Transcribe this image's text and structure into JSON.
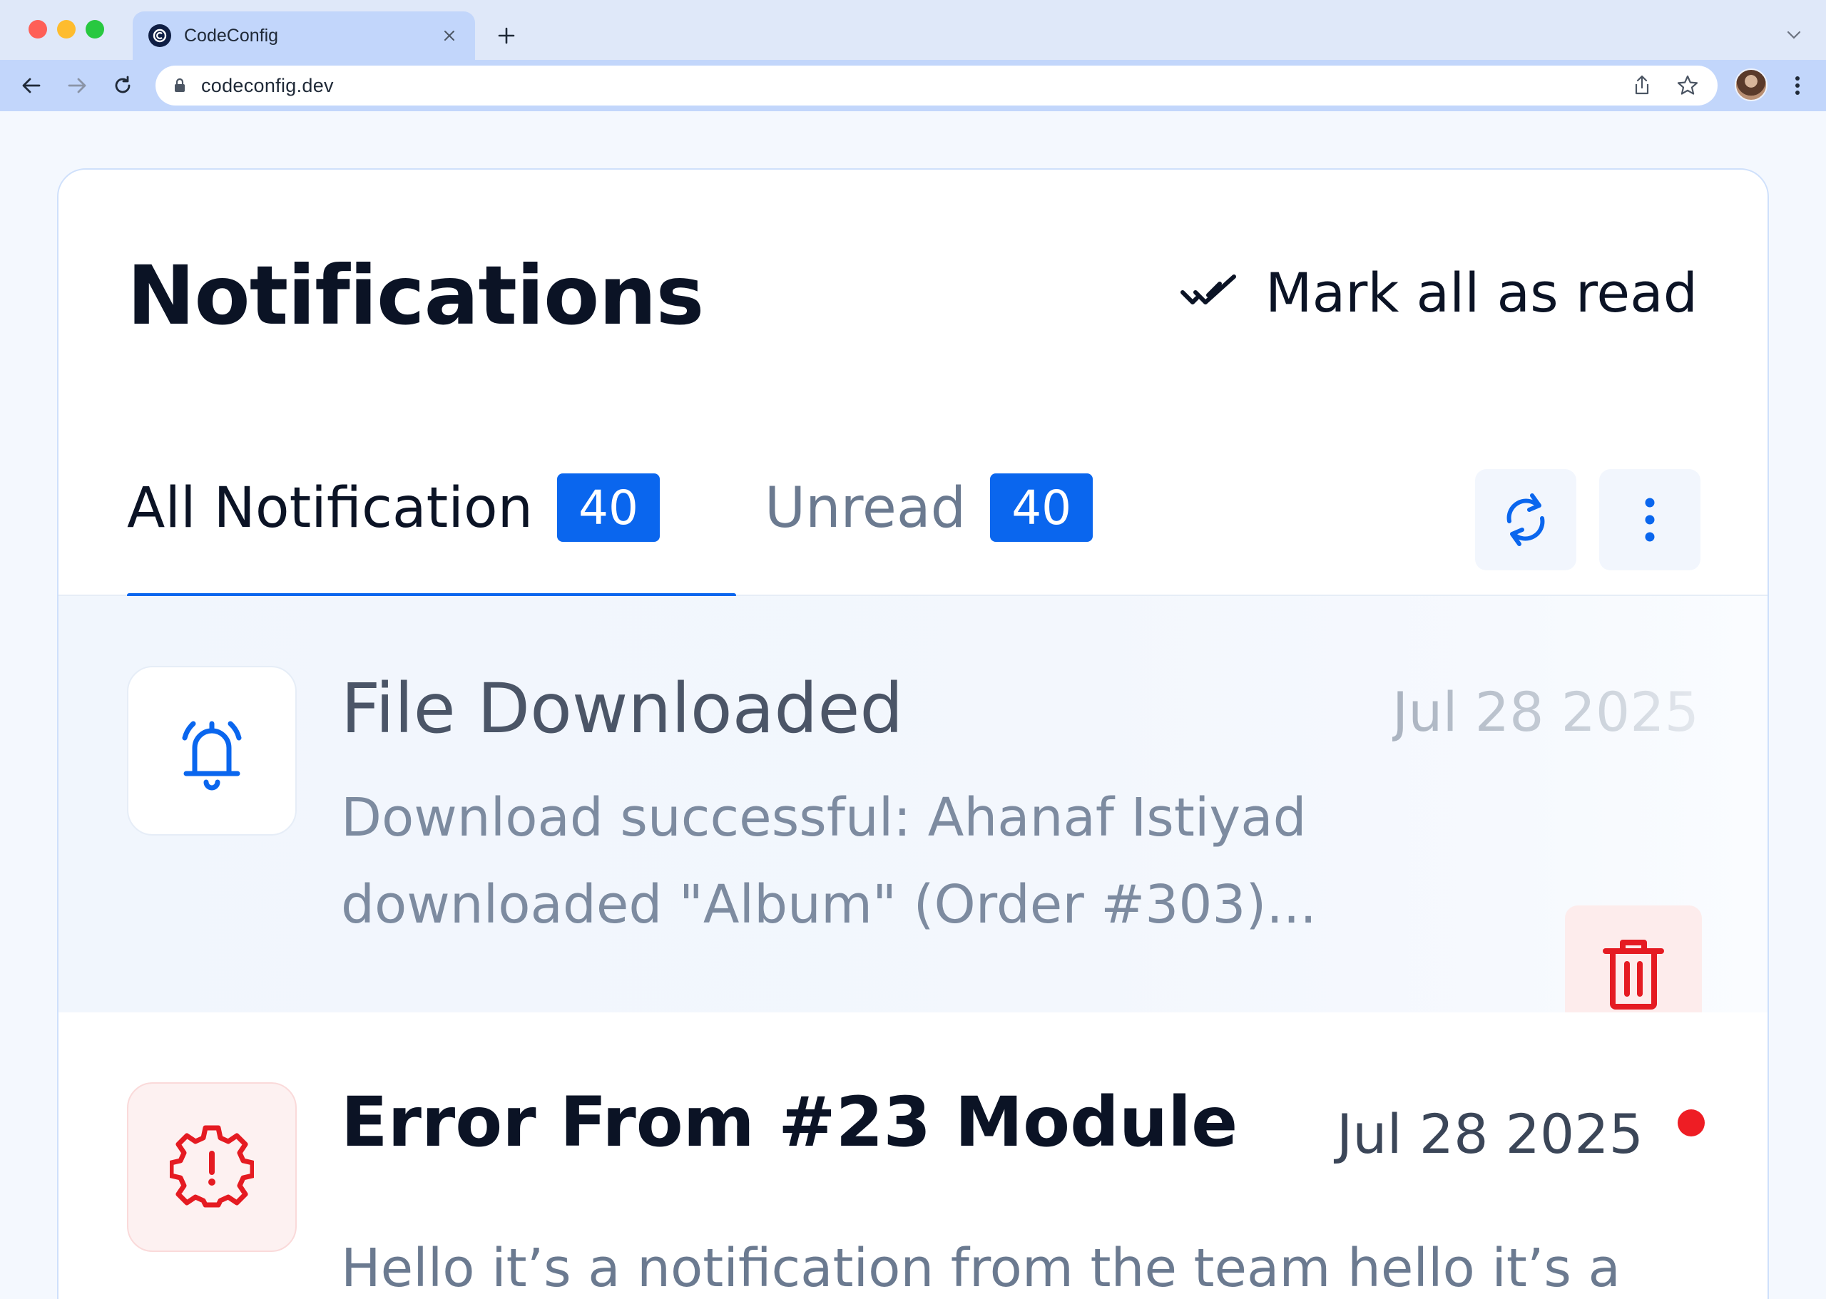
{
  "browser": {
    "tab_title": "CodeConfig",
    "url": "codeconfig.dev"
  },
  "header": {
    "title": "Notifications",
    "mark_all_label": "Mark all as read"
  },
  "tabs": [
    {
      "label": "All Notification",
      "count": "40",
      "active": true
    },
    {
      "label": "Unread",
      "count": "40",
      "active": false
    }
  ],
  "notifications": [
    {
      "title": "File Downloaded",
      "body": "Download successful: Ahanaf Istiyad downloaded \"Album\" (Order #303)...",
      "date": "Jul 28 2025",
      "icon": "bell-icon",
      "read": true
    },
    {
      "title": "Error From #23 Module",
      "body": "Hello it’s a notification from the team hello it’s a",
      "date": "Jul 28 2025",
      "icon": "gear-error-icon",
      "read": false
    }
  ],
  "colors": {
    "accent": "#0a66ee",
    "danger": "#ee1d24",
    "danger_bg": "#fdecec"
  }
}
